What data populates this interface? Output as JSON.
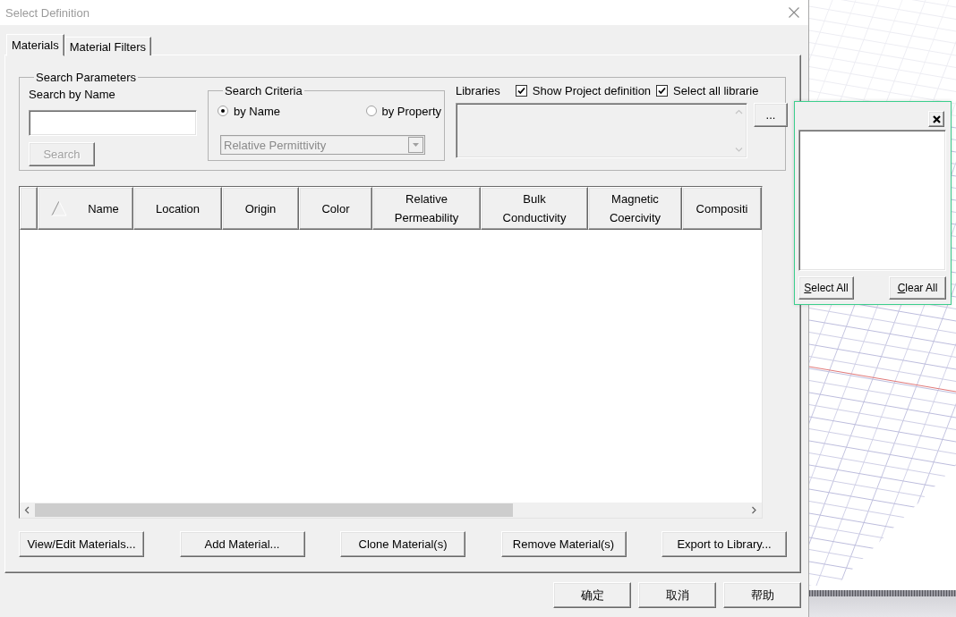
{
  "window": {
    "title": "Select Definition"
  },
  "tabs": [
    {
      "label": "Materials",
      "selected": true
    },
    {
      "label": "Material Filters",
      "selected": false
    }
  ],
  "search_parameters": {
    "title": "Search Parameters",
    "name_label": "Search by Name",
    "search_button": {
      "label": "Search",
      "disabled": true
    },
    "search_criteria": {
      "title": "Search Criteria",
      "options": [
        {
          "label": "by Name",
          "selected": true
        },
        {
          "label": "by Property",
          "selected": false
        }
      ],
      "property": {
        "value": "Relative Permittivity",
        "disabled": true
      }
    },
    "libraries": {
      "label": "Libraries",
      "options": [
        {
          "label": "Show Project definition",
          "checked": true
        },
        {
          "label": "Select all librarie",
          "checked": true
        }
      ],
      "browse_button": "..."
    }
  },
  "table": {
    "columns": [
      {
        "label": "Name",
        "sorted": true
      },
      {
        "label": "Location",
        "sorted": false
      },
      {
        "label": "Origin",
        "sorted": false
      },
      {
        "label": "Color",
        "sorted": false
      },
      {
        "label": "Relative\nPermeability",
        "sorted": false
      },
      {
        "label": "Bulk\nConductivity",
        "sorted": false
      },
      {
        "label": "Magnetic\nCoercivity",
        "sorted": false
      },
      {
        "label": "Compositi",
        "sorted": false
      }
    ]
  },
  "actions": [
    "View/Edit Materials...",
    "Add Material...",
    "Clone Material(s)",
    "Remove Material(s)",
    "Export to Library..."
  ],
  "dialog_buttons": [
    "确定",
    "取消",
    "帮助"
  ],
  "library_popup": {
    "buttons": [
      "Select All",
      "Clear All"
    ]
  }
}
